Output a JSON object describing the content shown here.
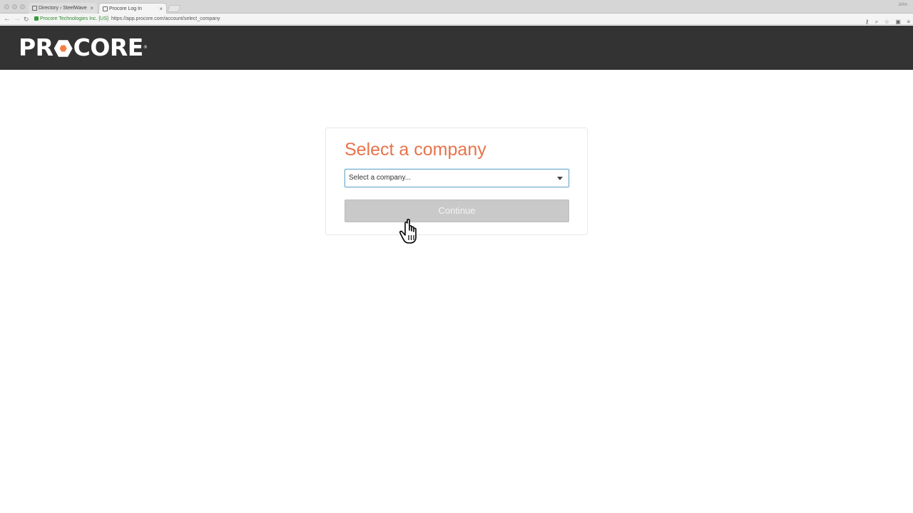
{
  "browser": {
    "tabs": [
      {
        "title": "Directory › SteelWave"
      },
      {
        "title": "Procore Log In"
      }
    ],
    "user": "John",
    "address_bar": {
      "secure_label": "Procore Technologies Inc. [US]",
      "url": "https://app.procore.com/account/select_company"
    }
  },
  "header": {
    "logo_text_left": "PR",
    "logo_text_right": "CORE",
    "logo_mark": "®",
    "accent_color": "#f47e42",
    "background_color": "#333333"
  },
  "card": {
    "title": "Select a company",
    "select": {
      "value": "Select a company..."
    },
    "continue_label": "Continue"
  },
  "colors": {
    "title": "#e8734a",
    "button_disabled": "#c9c9c9"
  }
}
